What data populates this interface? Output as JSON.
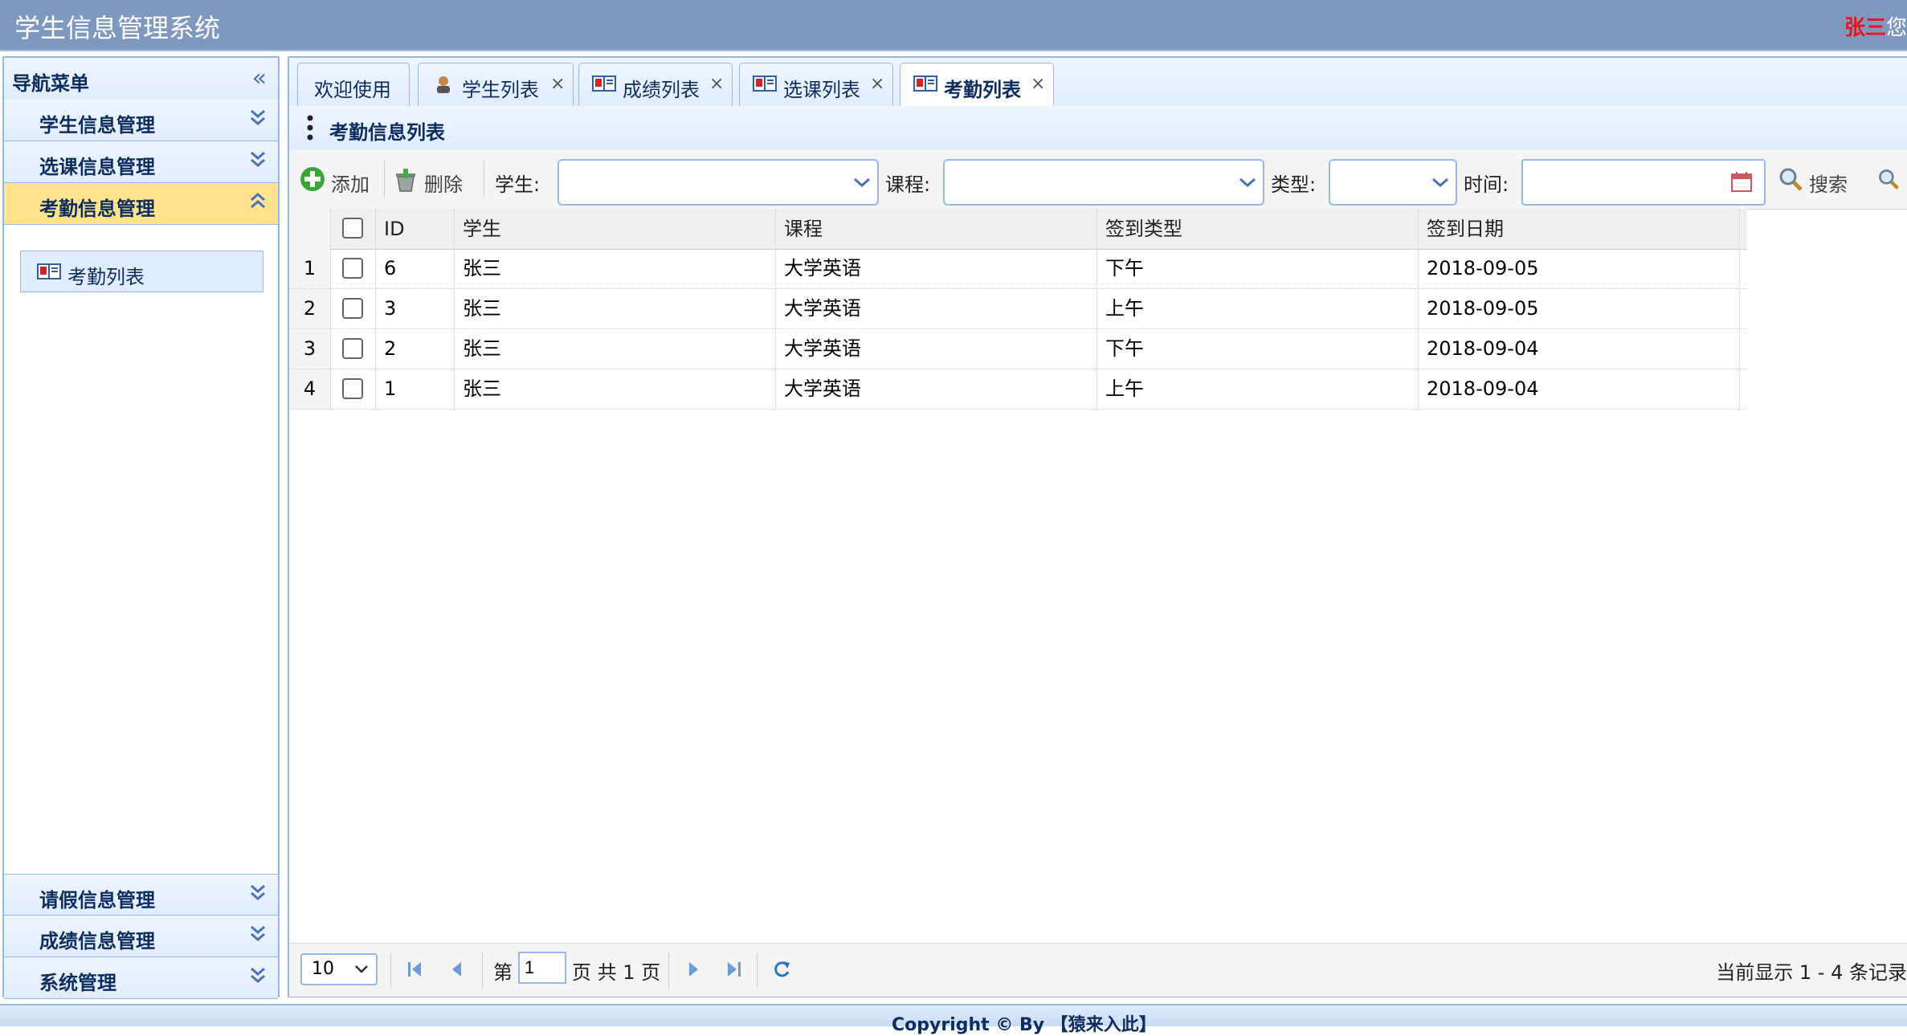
{
  "app": {
    "title": "学生信息管理系统",
    "user_name": "张三",
    "user_greet": "您"
  },
  "nav": {
    "title": "导航菜单",
    "sections": [
      {
        "label": "学生信息管理"
      },
      {
        "label": "选课信息管理"
      },
      {
        "label": "考勤信息管理",
        "selected": true
      },
      {
        "label": "请假信息管理"
      },
      {
        "label": "成绩信息管理"
      },
      {
        "label": "系统管理"
      }
    ],
    "active_item": "考勤列表"
  },
  "tabs": [
    {
      "label": "欢迎使用"
    },
    {
      "label": "学生列表"
    },
    {
      "label": "成绩列表"
    },
    {
      "label": "选课列表"
    },
    {
      "label": "考勤列表",
      "active": true
    }
  ],
  "tab_close": "×",
  "panel": {
    "title": "考勤信息列表"
  },
  "toolbar": {
    "add_label": "添加",
    "delete_label": "删除",
    "student_label": "学生:",
    "course_label": "课程:",
    "type_label": "类型:",
    "time_label": "时间:",
    "search_label": "搜索",
    "student_value": "",
    "course_value": "",
    "type_value": "",
    "time_value": ""
  },
  "grid": {
    "columns": [
      "ID",
      "学生",
      "课程",
      "签到类型",
      "签到日期"
    ],
    "rows": [
      {
        "num": "1",
        "id": "6",
        "student": "张三",
        "course": "大学英语",
        "type": "下午",
        "date": "2018-09-05"
      },
      {
        "num": "2",
        "id": "3",
        "student": "张三",
        "course": "大学英语",
        "type": "上午",
        "date": "2018-09-05"
      },
      {
        "num": "3",
        "id": "2",
        "student": "张三",
        "course": "大学英语",
        "type": "下午",
        "date": "2018-09-04"
      },
      {
        "num": "4",
        "id": "1",
        "student": "张三",
        "course": "大学英语",
        "type": "上午",
        "date": "2018-09-04"
      }
    ]
  },
  "pager": {
    "page_size": "10",
    "page_prefix": "第",
    "page_value": "1",
    "page_suffix": "页 共 1 页",
    "info": "当前显示 1 - 4 条记录"
  },
  "footer": {
    "text": "Copyright © By 【猿来入此】"
  },
  "colors": {
    "header_bg": "#7f99be",
    "border": "#95b8e7",
    "selected_section": "#ffe48d",
    "user_name": "#e8131f"
  }
}
